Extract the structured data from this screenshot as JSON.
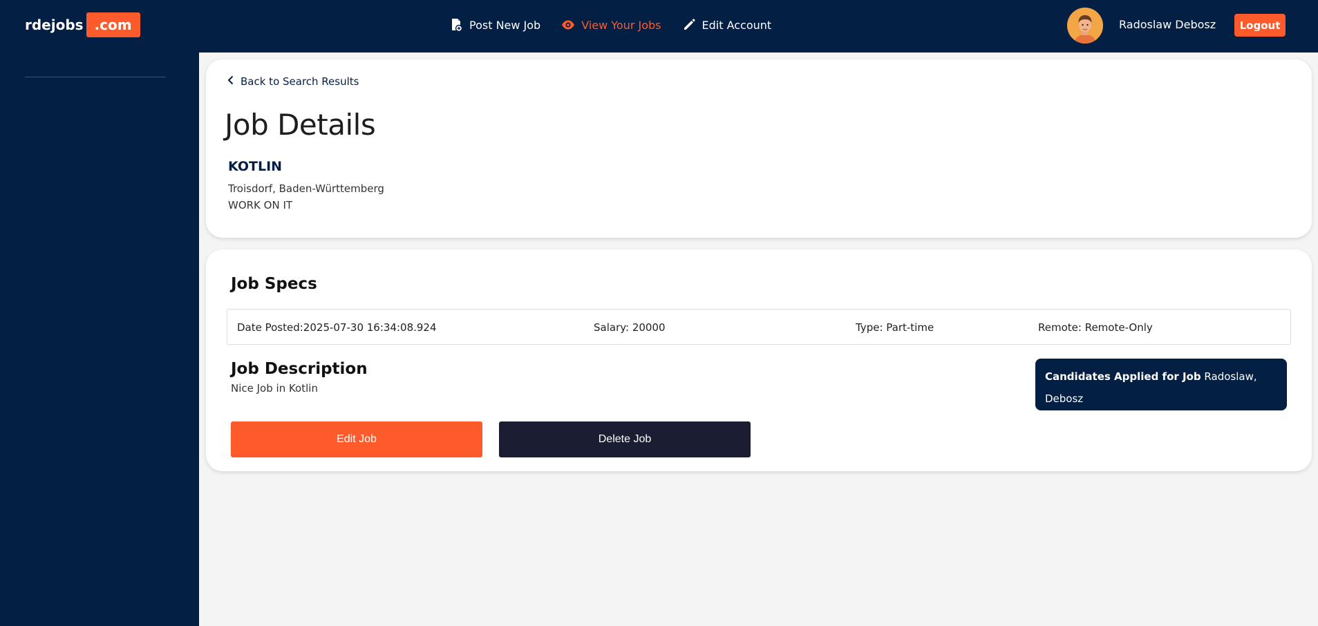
{
  "header": {
    "logo_text": "rdejobs",
    "logo_badge": ".com",
    "nav": [
      {
        "label": "Post New Job",
        "icon": "file-plus-icon",
        "active": false
      },
      {
        "label": "View Your Jobs",
        "icon": "eye-icon",
        "active": true
      },
      {
        "label": "Edit Account",
        "icon": "pencil-icon",
        "active": false
      }
    ],
    "user_name": "Radoslaw Debosz",
    "logout_label": "Logout"
  },
  "job_card": {
    "back_label": "Back to Search Results",
    "page_title": "Job Details",
    "job_title": "KOTLIN",
    "location": "Troisdorf, Baden-Württemberg",
    "company": "WORK ON IT"
  },
  "specs": {
    "title": "Job Specs",
    "date_posted": "Date Posted:2025-07-30 16:34:08.924",
    "salary": "Salary: 20000",
    "type": "Type: Part-time",
    "remote": "Remote: Remote-Only"
  },
  "description": {
    "title": "Job Description",
    "text": "Nice Job in Kotlin"
  },
  "candidates": {
    "label": "Candidates Applied for Job",
    "names": "Radoslaw, Debosz"
  },
  "actions": {
    "edit_label": "Edit Job",
    "delete_label": "Delete Job"
  },
  "colors": {
    "navy": "#041f44",
    "accent": "#fd5b2c",
    "dark_button": "#1b1d32",
    "background": "#f4f4f4"
  }
}
